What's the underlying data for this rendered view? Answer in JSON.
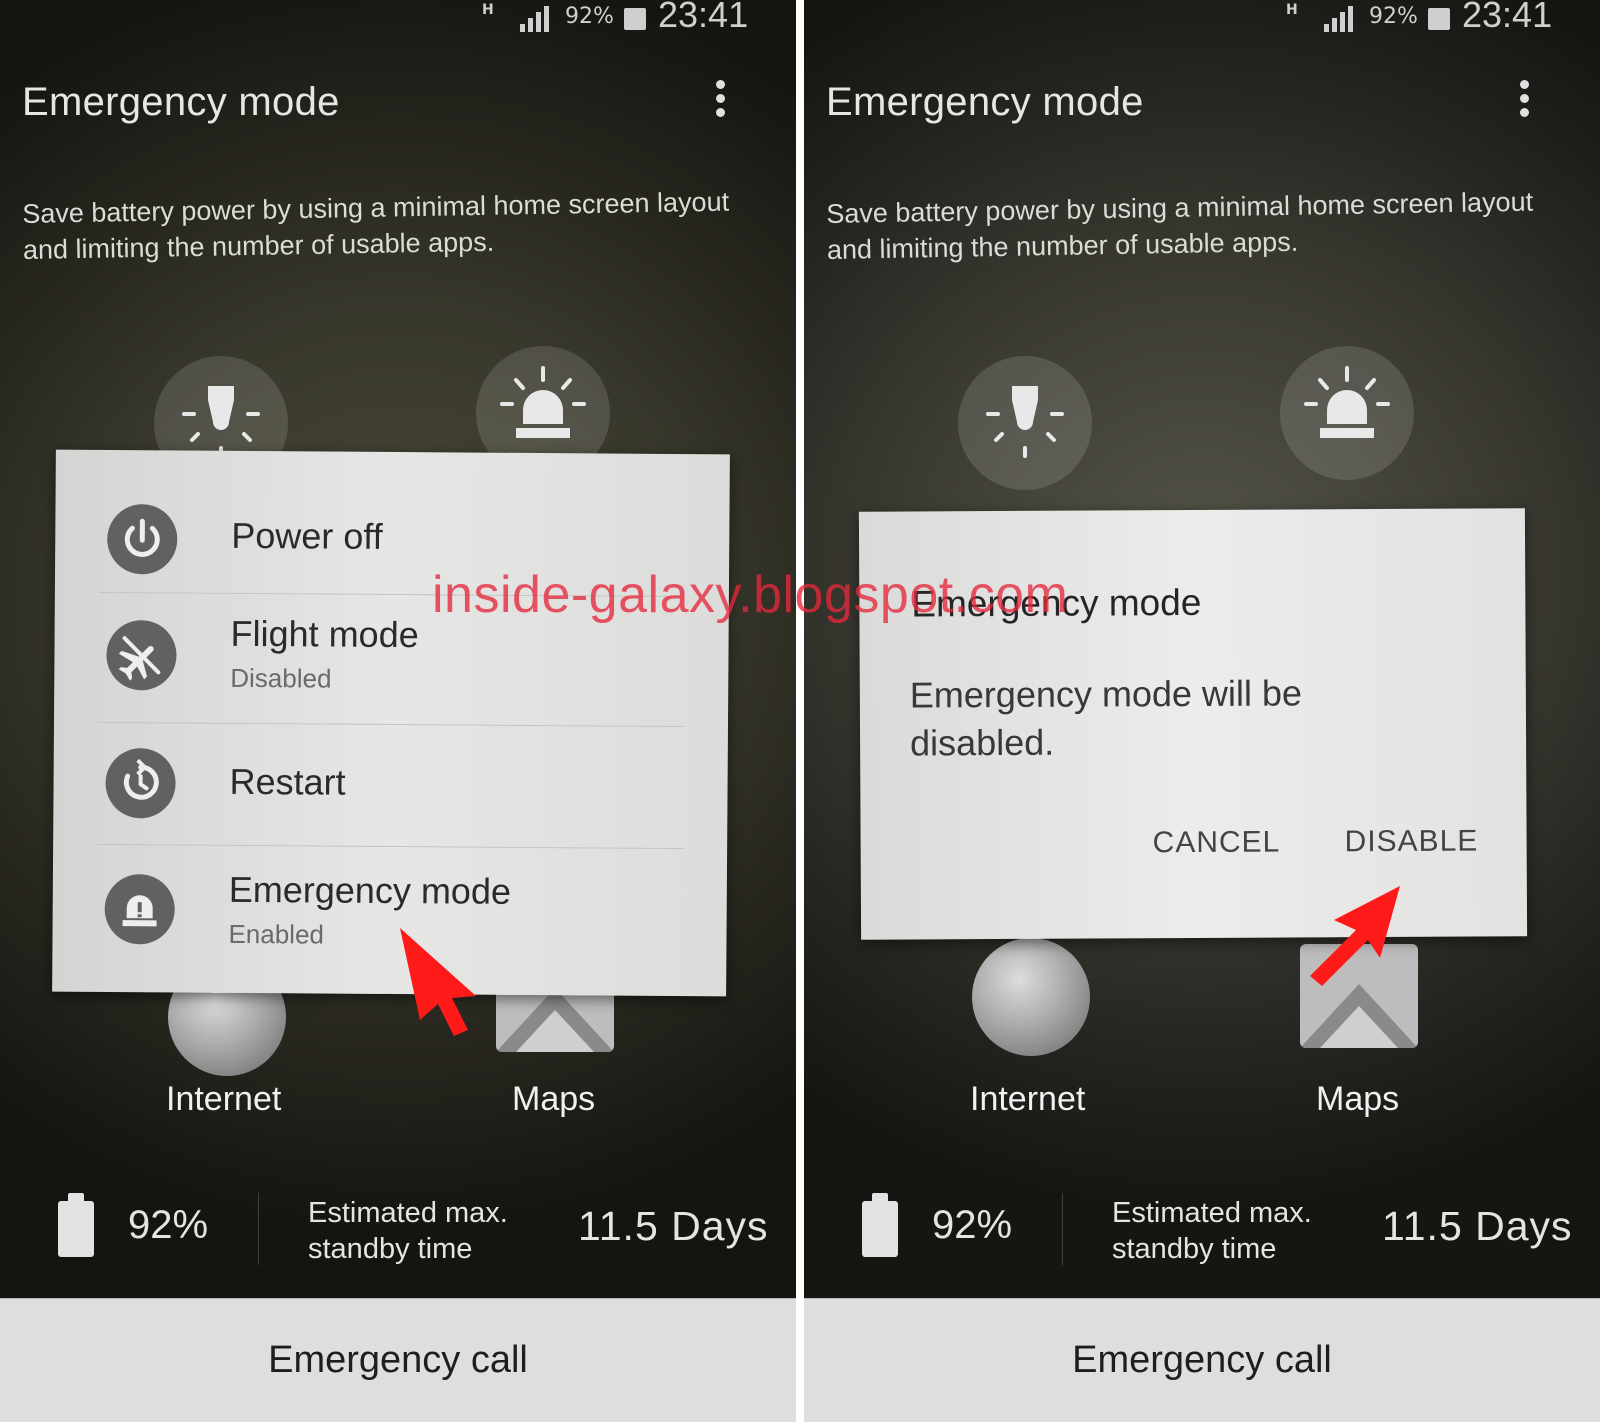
{
  "status": {
    "network": "H",
    "battery": "92%",
    "time": "23:41"
  },
  "screen": {
    "title": "Emergency mode",
    "description": "Save battery power by using a minimal home screen layout and limiting the number of usable apps."
  },
  "apps": [
    {
      "label": "Internet",
      "icon": "globe-icon"
    },
    {
      "label": "Maps",
      "icon": "maps-icon"
    }
  ],
  "battery_info": {
    "percent": "92%",
    "estimate_label": "Estimated max. standby time",
    "estimate_line1": "Estimated max.",
    "estimate_line2": "standby time",
    "days": "11.5 Days"
  },
  "emergency_call": "Emergency call",
  "power_menu": {
    "items": [
      {
        "label": "Power off",
        "sub": "",
        "icon": "power-icon"
      },
      {
        "label": "Flight mode",
        "sub": "Disabled",
        "icon": "airplane-off-icon"
      },
      {
        "label": "Restart",
        "sub": "",
        "icon": "restart-icon"
      },
      {
        "label": "Emergency mode",
        "sub": "Enabled",
        "icon": "emergency-siren-icon"
      }
    ]
  },
  "dialog": {
    "title": "Emergency mode",
    "message": "Emergency mode will be disabled.",
    "cancel": "CANCEL",
    "confirm": "DISABLE"
  },
  "watermark": "inside-galaxy.blogspot.com",
  "colors": {
    "accent_arrow": "#ff1a1a",
    "watermark": "#e6283c",
    "dialog_bg": "#e6e6e4"
  }
}
